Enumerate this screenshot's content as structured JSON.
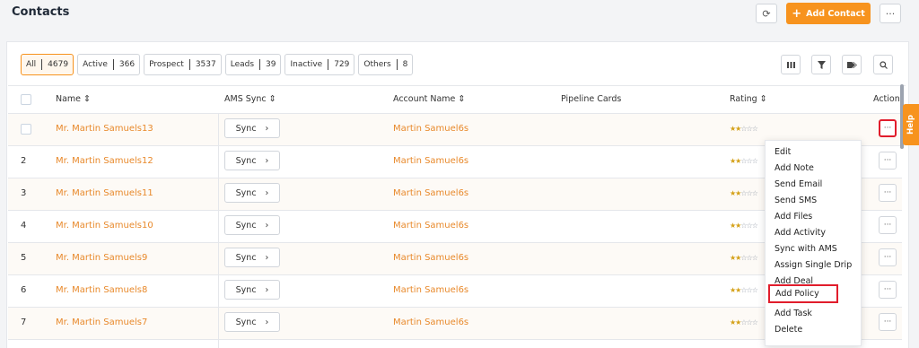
{
  "header": {
    "title": "Contacts",
    "add_button": "Add Contact",
    "add_icon": "+",
    "refresh_icon": "⟳",
    "more_icon": "···"
  },
  "filters": [
    {
      "label": "All",
      "count": "4679",
      "active": true
    },
    {
      "label": "Active",
      "count": "366"
    },
    {
      "label": "Prospect",
      "count": "3537"
    },
    {
      "label": "Leads",
      "count": "39"
    },
    {
      "label": "Inactive",
      "count": "729"
    },
    {
      "label": "Others",
      "count": "8"
    }
  ],
  "toolbar_icons": [
    "columns-icon",
    "filter-icon",
    "tag-icon",
    "search-icon"
  ],
  "columns": {
    "name": "Name ⇕",
    "ams_sync": "AMS Sync ⇕",
    "account_name": "Account Name ⇕",
    "pipeline_cards": "Pipeline Cards",
    "rating": "Rating ⇕",
    "action": "Action"
  },
  "rows": [
    {
      "num": "",
      "name": "Mr. Martin Samuels13",
      "sync": "Sync",
      "account": "Martin Samuel6s",
      "rating": 2
    },
    {
      "num": "2",
      "name": "Mr. Martin Samuels12",
      "sync": "Sync",
      "account": "Martin Samuel6s",
      "rating": 2
    },
    {
      "num": "3",
      "name": "Mr. Martin Samuels11",
      "sync": "Sync",
      "account": "Martin Samuel6s",
      "rating": 2
    },
    {
      "num": "4",
      "name": "Mr. Martin Samuels10",
      "sync": "Sync",
      "account": "Martin Samuel6s",
      "rating": 2
    },
    {
      "num": "5",
      "name": "Mr. Martin Samuels9",
      "sync": "Sync",
      "account": "Martin Samuel6s",
      "rating": 2
    },
    {
      "num": "6",
      "name": "Mr. Martin Samuels8",
      "sync": "Sync",
      "account": "Martin Samuel6s",
      "rating": 2
    },
    {
      "num": "7",
      "name": "Mr. Martin Samuels7",
      "sync": "Sync",
      "account": "Martin Samuel6s",
      "rating": 2
    }
  ],
  "sync_chevron": "›",
  "action_icon": "···",
  "dropdown": {
    "items": [
      "Edit",
      "Add Note",
      "Send Email",
      "Send SMS",
      "Add Files",
      "Add Activity",
      "Sync with AMS",
      "Assign Single Drip",
      "Add Deal",
      "Add Policy",
      "Add Task",
      "Delete"
    ],
    "highlighted": "Add Policy"
  },
  "help_tab": "Help",
  "colors": {
    "accent": "#f7931e",
    "link": "#e8892b",
    "highlight": "#e11d2c"
  }
}
